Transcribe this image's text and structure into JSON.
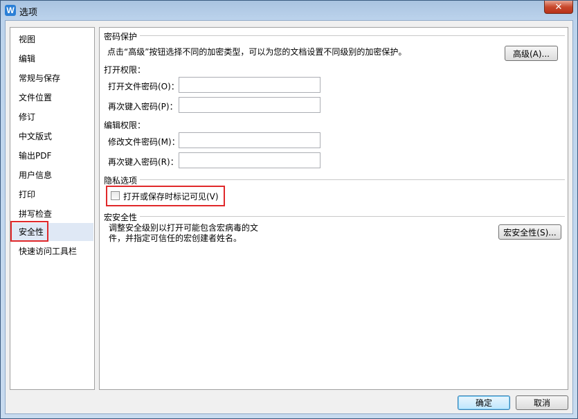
{
  "window": {
    "title": "选项",
    "app_icon_letter": "W",
    "close_symbol": "✕"
  },
  "sidebar": {
    "items": [
      {
        "label": "视图"
      },
      {
        "label": "编辑"
      },
      {
        "label": "常规与保存"
      },
      {
        "label": "文件位置"
      },
      {
        "label": "修订"
      },
      {
        "label": "中文版式"
      },
      {
        "label": "输出PDF"
      },
      {
        "label": "用户信息"
      },
      {
        "label": "打印"
      },
      {
        "label": "拼写检查"
      },
      {
        "label": "安全性"
      },
      {
        "label": "快速访问工具栏"
      }
    ],
    "selected_index": 10
  },
  "password_section": {
    "title": "密码保护",
    "description": "点击“高级”按钮选择不同的加密类型，可以为您的文档设置不同级别的加密保护。",
    "advanced_button": "高级(A)...",
    "open_permission_title": "打开权限：",
    "open_password_label": "打开文件密码(O)：",
    "open_password_value": "",
    "open_password_confirm_label": "再次键入密码(P)：",
    "open_password_confirm_value": "",
    "edit_permission_title": "编辑权限：",
    "edit_password_label": "修改文件密码(M)：",
    "edit_password_value": "",
    "edit_password_confirm_label": "再次键入密码(R)：",
    "edit_password_confirm_value": ""
  },
  "privacy_section": {
    "title": "隐私选项",
    "checkbox_label": "打开或保存时标记可见(V)",
    "checked": false
  },
  "macro_section": {
    "title": "宏安全性",
    "description_line1": "调整安全级别以打开可能包含宏病毒的文",
    "description_line2": "件，并指定可信任的宏创建者姓名。",
    "button": "宏安全性(S)..."
  },
  "footer": {
    "ok_label": "确定",
    "cancel_label": "取消"
  },
  "colors": {
    "highlight_red": "#e0282a",
    "selected_bg": "#dfe8f5"
  }
}
